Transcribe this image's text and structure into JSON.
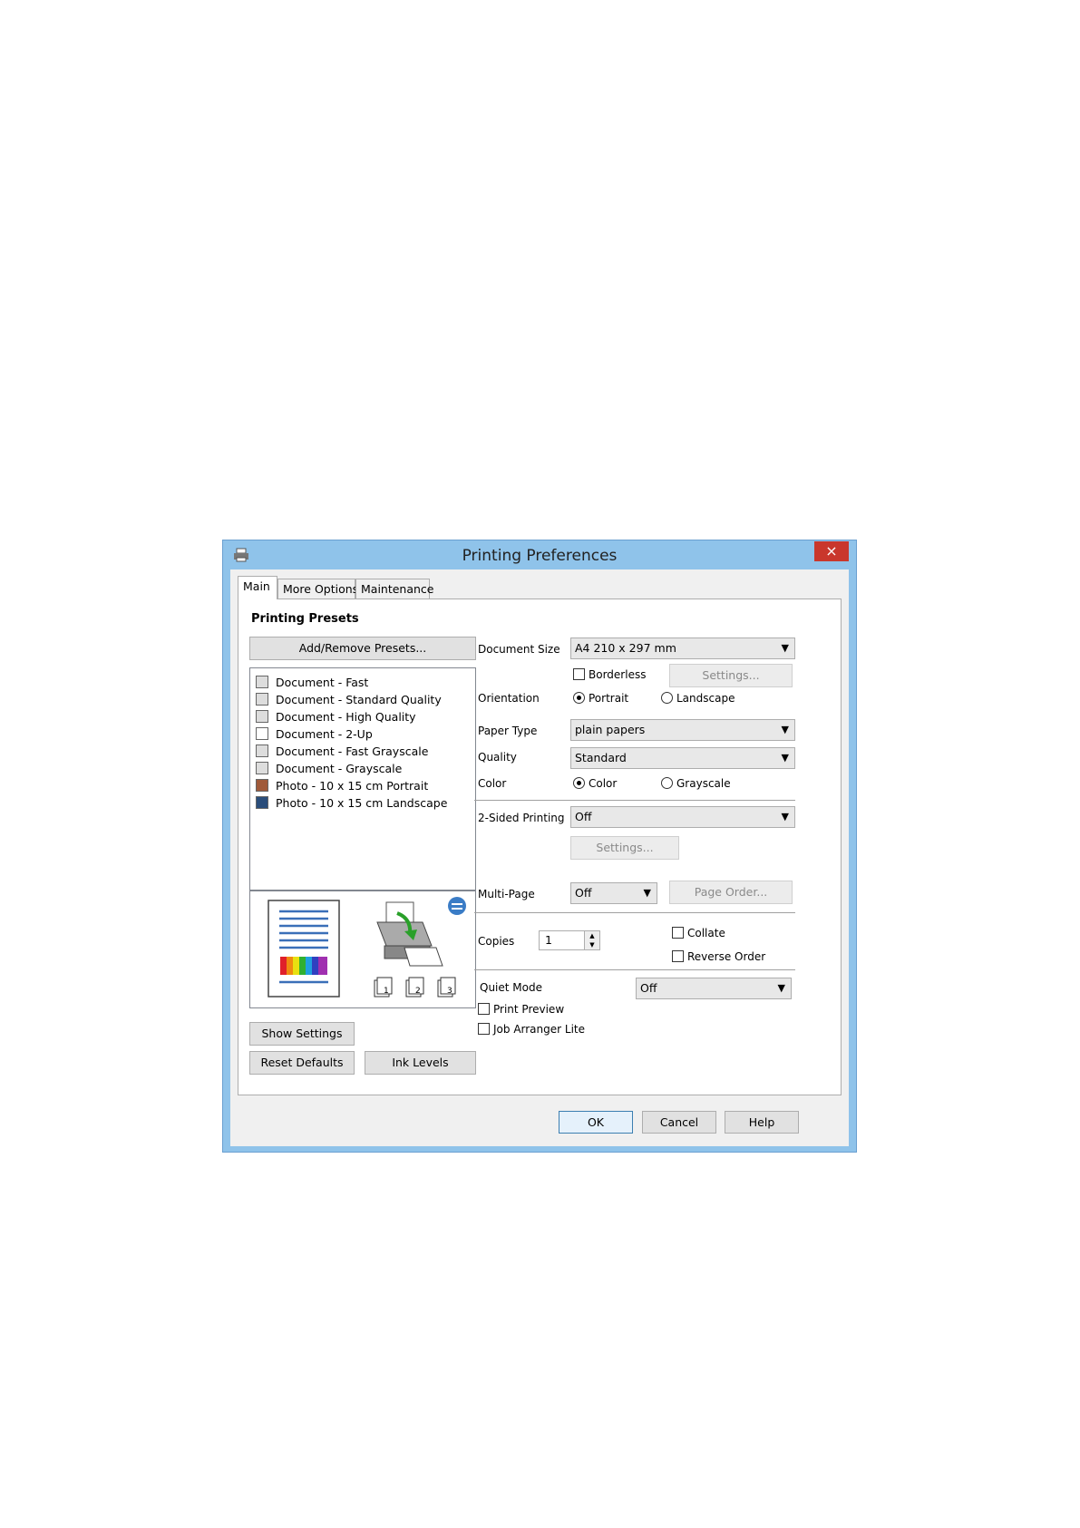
{
  "window": {
    "title": "Printing Preferences",
    "close_label": "×"
  },
  "tabs": [
    "Main",
    "More Options",
    "Maintenance"
  ],
  "presets": {
    "heading": "Printing Presets",
    "add_remove_label": "Add/Remove Presets...",
    "items": [
      "Document - Fast",
      "Document - Standard Quality",
      "Document - High Quality",
      "Document - 2-Up",
      "Document - Fast Grayscale",
      "Document - Grayscale",
      "Photo - 10 x 15 cm Portrait",
      "Photo - 10 x 15 cm Landscape"
    ]
  },
  "buttons": {
    "show_settings": "Show Settings",
    "reset_defaults": "Reset Defaults",
    "ink_levels": "Ink Levels",
    "ok": "OK",
    "cancel": "Cancel",
    "help": "Help"
  },
  "settings": {
    "document_size_label": "Document Size",
    "document_size_value": "A4 210 x 297 mm",
    "borderless_label": "Borderless",
    "borderless_settings": "Settings...",
    "orientation_label": "Orientation",
    "portrait_label": "Portrait",
    "landscape_label": "Landscape",
    "paper_type_label": "Paper Type",
    "paper_type_value": "plain papers",
    "quality_label": "Quality",
    "quality_value": "Standard",
    "color_label": "Color",
    "color_option": "Color",
    "grayscale_option": "Grayscale",
    "two_sided_label": "2-Sided Printing",
    "two_sided_value": "Off",
    "two_sided_settings": "Settings...",
    "multipage_label": "Multi-Page",
    "multipage_value": "Off",
    "page_order_label": "Page Order...",
    "copies_label": "Copies",
    "copies_value": "1",
    "collate_label": "Collate",
    "reverse_order_label": "Reverse Order",
    "quiet_mode_label": "Quiet Mode",
    "quiet_mode_value": "Off",
    "print_preview_label": "Print Preview",
    "job_arranger_label": "Job Arranger Lite"
  },
  "preview_page_numbers": [
    "1",
    "2",
    "3"
  ]
}
